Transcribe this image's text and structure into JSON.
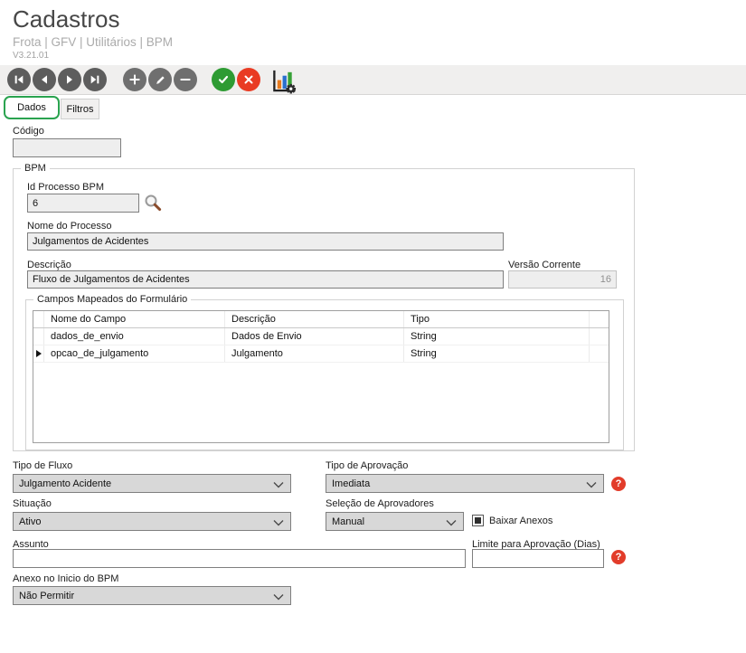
{
  "header": {
    "title": "Cadastros",
    "breadcrumb": "Frota | GFV | Utilitários | BPM",
    "version": "V3.21.01"
  },
  "toolbar": {
    "buttons": [
      "first-record",
      "previous-record",
      "next-record",
      "last-record",
      "insert-record",
      "edit-record",
      "delete-record",
      "confirm",
      "cancel",
      "chart-settings"
    ]
  },
  "tabs": [
    {
      "label": "Dados",
      "active": true
    },
    {
      "label": "Filtros",
      "active": false
    }
  ],
  "form": {
    "codigo": {
      "label": "Código",
      "value": ""
    },
    "bpm": {
      "legend": "BPM",
      "id_processo": {
        "label": "Id Processo BPM",
        "value": "6"
      },
      "nome_processo": {
        "label": "Nome do Processo",
        "value": "Julgamentos de Acidentes"
      },
      "descricao": {
        "label": "Descrição",
        "value": "Fluxo de Julgamentos de Acidentes"
      },
      "versao_corrente": {
        "label": "Versão Corrente",
        "value": "16"
      },
      "campos": {
        "legend": "Campos Mapeados do Formulário",
        "columns": [
          "Nome do Campo",
          "Descrição",
          "Tipo"
        ],
        "rows": [
          {
            "nome": "dados_de_envio",
            "descricao": "Dados de Envio",
            "tipo": "String",
            "selected": false
          },
          {
            "nome": "opcao_de_julgamento",
            "descricao": "Julgamento",
            "tipo": "String",
            "selected": true
          }
        ]
      }
    },
    "tipo_fluxo": {
      "label": "Tipo de Fluxo",
      "value": "Julgamento Acidente"
    },
    "tipo_aprovacao": {
      "label": "Tipo de Aprovação",
      "value": "Imediata"
    },
    "situacao": {
      "label": "Situação",
      "value": "Ativo"
    },
    "selecao_aprovadores": {
      "label": "Seleção de Aprovadores",
      "value": "Manual"
    },
    "baixar_anexos": {
      "label": "Baixar Anexos",
      "checked": true
    },
    "assunto": {
      "label": "Assunto",
      "value": ""
    },
    "limite_aprovacao": {
      "label": "Limite para Aprovação (Dias)",
      "value": ""
    },
    "anexo_inicio": {
      "label": "Anexo no Inicio do BPM",
      "value": "Não Permitir"
    }
  },
  "colors": {
    "confirm_green": "#2e9b33",
    "cancel_red": "#e93b23",
    "active_tab_outline": "#2aa34f",
    "help_red": "#e23c2a",
    "chart_orange": "#e87b1e",
    "chart_blue": "#2a6fce",
    "chart_green": "#36a136"
  }
}
